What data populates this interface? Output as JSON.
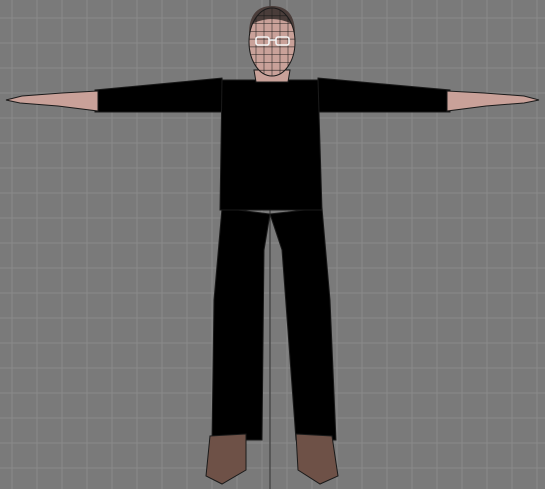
{
  "viewport": {
    "view": "front-orthographic",
    "background_color": "#7a7a7a",
    "grid": true,
    "grid_color": "#8a8a8a",
    "axis_line_color": "#3e3e3e",
    "wireframe_overlay": true
  },
  "model": {
    "pose": "T-pose",
    "skin_color": "#c9a199",
    "hair_color": "#4a3d3a",
    "sweater_light": "#b7c3b3",
    "sweater_dark": "#3f5041",
    "trousers_color": "#9a8163",
    "shoes_color": "#6e5147",
    "wire_color": "#1a1a1a",
    "visible_parts": [
      "head",
      "torso",
      "left-arm",
      "right-arm",
      "left-hand",
      "right-hand",
      "left-leg",
      "right-leg",
      "left-shoe",
      "right-shoe"
    ]
  }
}
